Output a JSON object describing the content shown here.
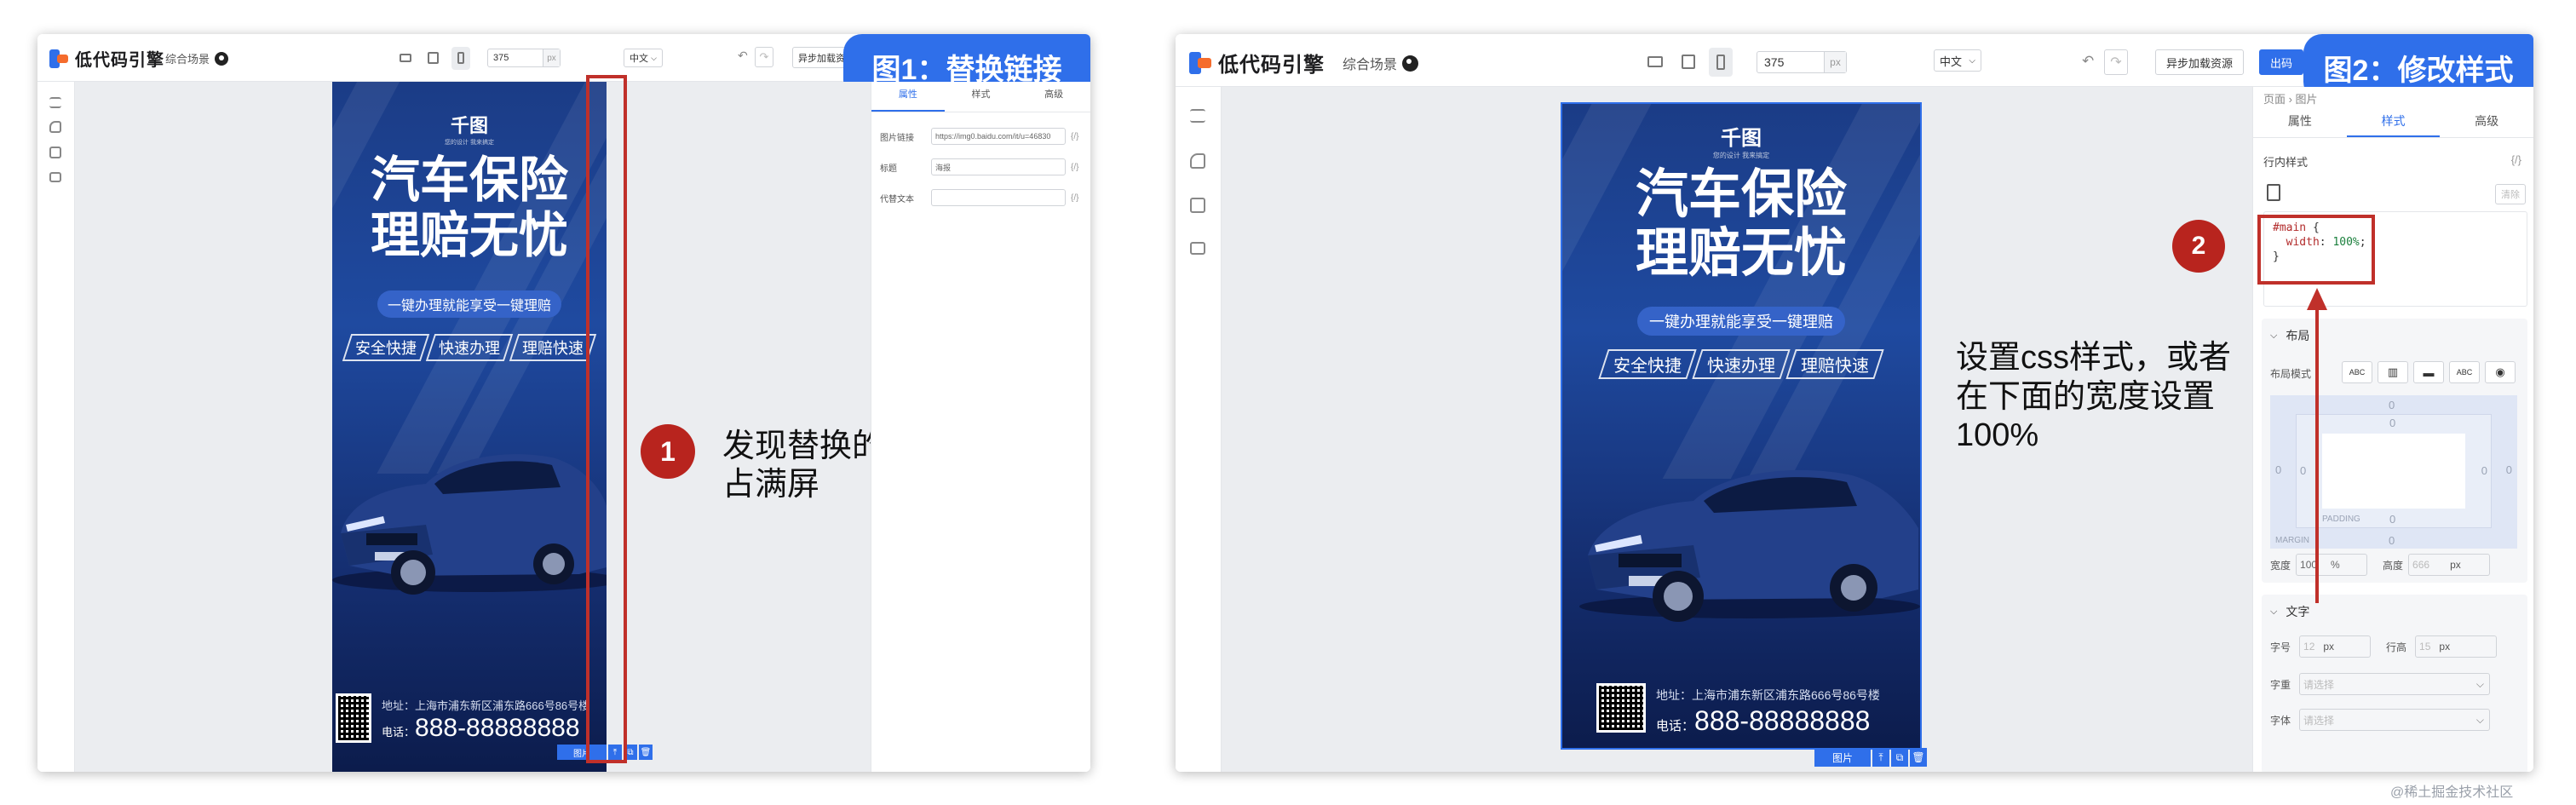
{
  "app": {
    "logo_text": "低代码引擎",
    "scene_label": "综合场景",
    "width_value": "375",
    "width_unit": "px",
    "lang": "中文",
    "async_btn": "异步加载资源",
    "async_btn_short": "异步加载资",
    "export_btn": "出码"
  },
  "panel1": {
    "banner": "图1：替换链接",
    "tabs": [
      "属性",
      "样式",
      "高级"
    ],
    "fields": [
      {
        "label": "图片链接",
        "value": "https://img0.baidu.com/it/u=46830",
        "bracket": "{/}"
      },
      {
        "label": "标题",
        "value": "海报",
        "bracket": "{/}"
      },
      {
        "label": "代替文本",
        "value": "",
        "bracket": "{/}"
      }
    ],
    "annotation_num": "1",
    "annotation_text_1": "发现替换的图片没有",
    "annotation_text_2": "占满屏",
    "selected_tag": "图片"
  },
  "panel2": {
    "banner": "图2：修改样式",
    "breadcrumb": "页面 › 图片",
    "tabs": [
      "属性",
      "样式",
      "高级"
    ],
    "inline_style_label": "行内样式",
    "inline_style_bracket": "{/}",
    "clear_btn": "清除",
    "code": {
      "line1_sel": "#main",
      "line1_brace": " {",
      "line2_prop": "  width",
      "line2_colon": ": ",
      "line2_val": "100%",
      "line2_semi": ";",
      "line3": "}"
    },
    "annotation_num": "2",
    "annotation_text_1": "设置css样式，或者",
    "annotation_text_2": "在下面的宽度设置",
    "annotation_text_3": "100%",
    "layout_title": "布局",
    "layout_mode_label": "布局模式",
    "layout_modes": [
      "ABC",
      "▥",
      "▬",
      "ABC",
      "◉"
    ],
    "box_margin_label": "MARGIN",
    "box_padding_label": "PADDING",
    "box_zero": "0",
    "width_label": "宽度",
    "width_value": "100",
    "width_unit": "%",
    "height_label": "高度",
    "height_value": "666",
    "height_unit": "px",
    "text_title": "文字",
    "font_size_label": "字号",
    "font_size_value": "12",
    "font_size_unit": "px",
    "line_height_label": "行高",
    "line_height_value": "15",
    "line_height_unit": "px",
    "font_weight_label": "字重",
    "font_family_label": "字体",
    "select_placeholder": "请选择",
    "selected_tag": "图片"
  },
  "poster": {
    "brand": "千图",
    "brand_sub": "您的设计 我来搞定",
    "title_line1": "汽车保险",
    "title_line2": "理赔无忧",
    "pill": "一键办理就能享受一键理赔",
    "tags": [
      "安全快捷",
      "快速办理",
      "理赔快速"
    ],
    "address": "地址：上海市浦东新区浦东路666号86号楼",
    "phone_label": "电话：",
    "phone": "888-88888888"
  },
  "watermark": "@稀土掘金技术社区",
  "colors": {
    "accent": "#2f6fea",
    "annotation_red": "#c0302a",
    "poster_bg": "#1f4aa0"
  }
}
